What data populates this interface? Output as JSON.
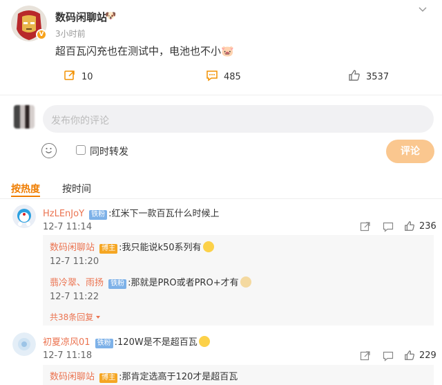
{
  "post": {
    "author": "数码闲聊站",
    "author_badge": "🐶",
    "verified_badge": "V",
    "time": "3小时前",
    "text": "超百瓦闪充也在测试中，电池也不小",
    "text_emoji": "🐷",
    "forward_count": "10",
    "comment_count": "485",
    "like_count": "3537"
  },
  "composer": {
    "placeholder": "发布你的评论",
    "forward_label": "同时转发",
    "submit_label": "评论"
  },
  "sort": {
    "hot_label": "按热度",
    "time_label": "按时间"
  },
  "comments": [
    {
      "user": "HzLEnJoY",
      "fan_badge": "铁粉",
      "text": ":红米下一款百瓦什么时候上",
      "time": "12-7 11:14",
      "likes": "236",
      "replies": [
        {
          "user": "数码闲聊站",
          "badge": "博主",
          "text": ":我只能说k50系列有",
          "time": "12-7 11:20"
        },
        {
          "user": "翡冷翠、雨扬",
          "badge": "铁粉",
          "text": ":那就是PRO或者PRO+才有",
          "time": "12-7 11:22"
        }
      ],
      "more_replies": "共38条回复"
    },
    {
      "user": "初夏凉风01",
      "fan_badge": "铁粉",
      "text": ":120W是不是超百瓦",
      "time": "12-7 11:18",
      "likes": "229",
      "replies": [
        {
          "user": "数码闲聊站",
          "badge": "博主",
          "text": ":那肯定选高于120才是超百瓦"
        }
      ]
    }
  ],
  "colors": {
    "accent": "#ef7d00",
    "username": "#eb7350",
    "submit": "#fac78f",
    "fan_badge": "#7db1e8"
  }
}
